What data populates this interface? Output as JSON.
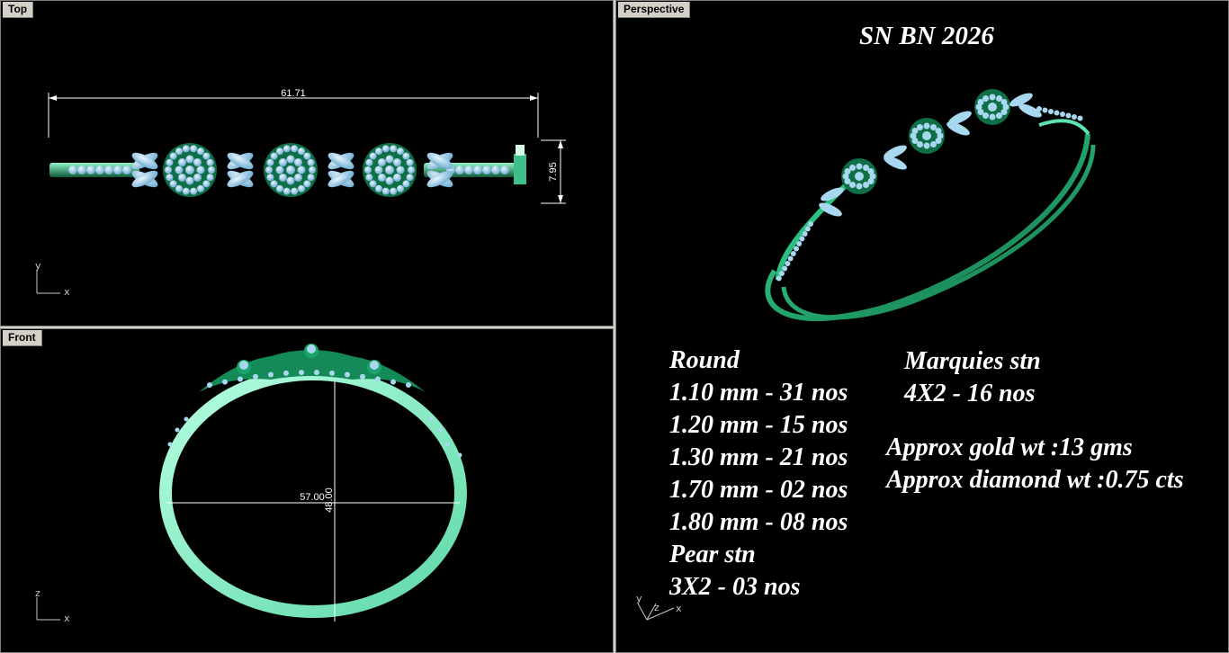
{
  "viewports": {
    "top": {
      "label": "Top",
      "axes": [
        "y",
        "x"
      ],
      "dims": {
        "length": "61.71",
        "width": "7.95"
      }
    },
    "front": {
      "label": "Front",
      "axes": [
        "z",
        "x"
      ],
      "dims": {
        "width": "57.00",
        "height": "48.00"
      }
    },
    "perspective": {
      "label": "Perspective",
      "axes": [
        "y",
        "z",
        "x"
      ]
    }
  },
  "design": {
    "code": "SN BN 2026"
  },
  "specs": {
    "round": {
      "heading": "Round",
      "lines": [
        "1.10 mm - 31 nos",
        "1.20 mm - 15 nos",
        "1.30 mm - 21 nos",
        "1.70 mm - 02 nos",
        "1.80 mm - 08 nos"
      ]
    },
    "pear": {
      "heading": "Pear stn",
      "line": "3X2 - 03 nos"
    },
    "marquise": {
      "heading": "Marquies stn",
      "line": "4X2 - 16 nos"
    },
    "weights": {
      "gold": "Approx gold wt :13 gms",
      "diamond": "Approx diamond wt :0.75 cts"
    }
  },
  "colors": {
    "metal": "#1f8a5a",
    "metal_light": "#7df0c0",
    "stone": "#a8d8f0",
    "background": "#000000",
    "chrome": "#d4d0c8"
  }
}
